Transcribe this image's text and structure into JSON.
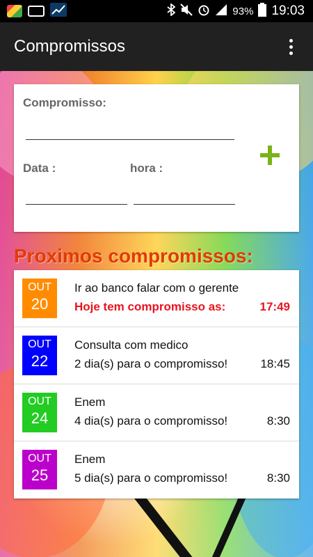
{
  "status_bar": {
    "time": "19:03",
    "battery": "93%",
    "left_icons": [
      "app-notification-icon",
      "voicemail-icon",
      "chart-icon"
    ],
    "right_icons": [
      "bluetooth-icon",
      "mute-icon",
      "alarm-icon",
      "signal-icon",
      "battery-icon"
    ]
  },
  "app_bar": {
    "title": "Compromissos"
  },
  "form": {
    "compromisso_label": "Compromisso:",
    "compromisso_value": "",
    "data_label": "Data :",
    "data_value": "",
    "hora_label": "hora :",
    "hora_value": "",
    "add_icon": "plus-icon",
    "add_color": "#7ab317"
  },
  "upcoming": {
    "title": "Proximos compromissos:",
    "title_color": "#e33a00",
    "items": [
      {
        "month": "OUT",
        "day": "20",
        "badge_color": "#ff8c00",
        "title": "Ir ao banco falar com o gerente",
        "subtitle": "Hoje tem compromisso as:",
        "time": "17:49",
        "today": true
      },
      {
        "month": "OUT",
        "day": "22",
        "badge_color": "#0000ff",
        "title": "Consulta com medico",
        "subtitle": "2 dia(s) para o compromisso!",
        "time": "18:45",
        "today": false
      },
      {
        "month": "OUT",
        "day": "24",
        "badge_color": "#22cc22",
        "title": "Enem",
        "subtitle": "4 dia(s) para o compromisso!",
        "time": "8:30",
        "today": false
      },
      {
        "month": "OUT",
        "day": "25",
        "badge_color": "#bb00cc",
        "title": "Enem",
        "subtitle": "5 dia(s) para o compromisso!",
        "time": "8:30",
        "today": false
      }
    ]
  }
}
